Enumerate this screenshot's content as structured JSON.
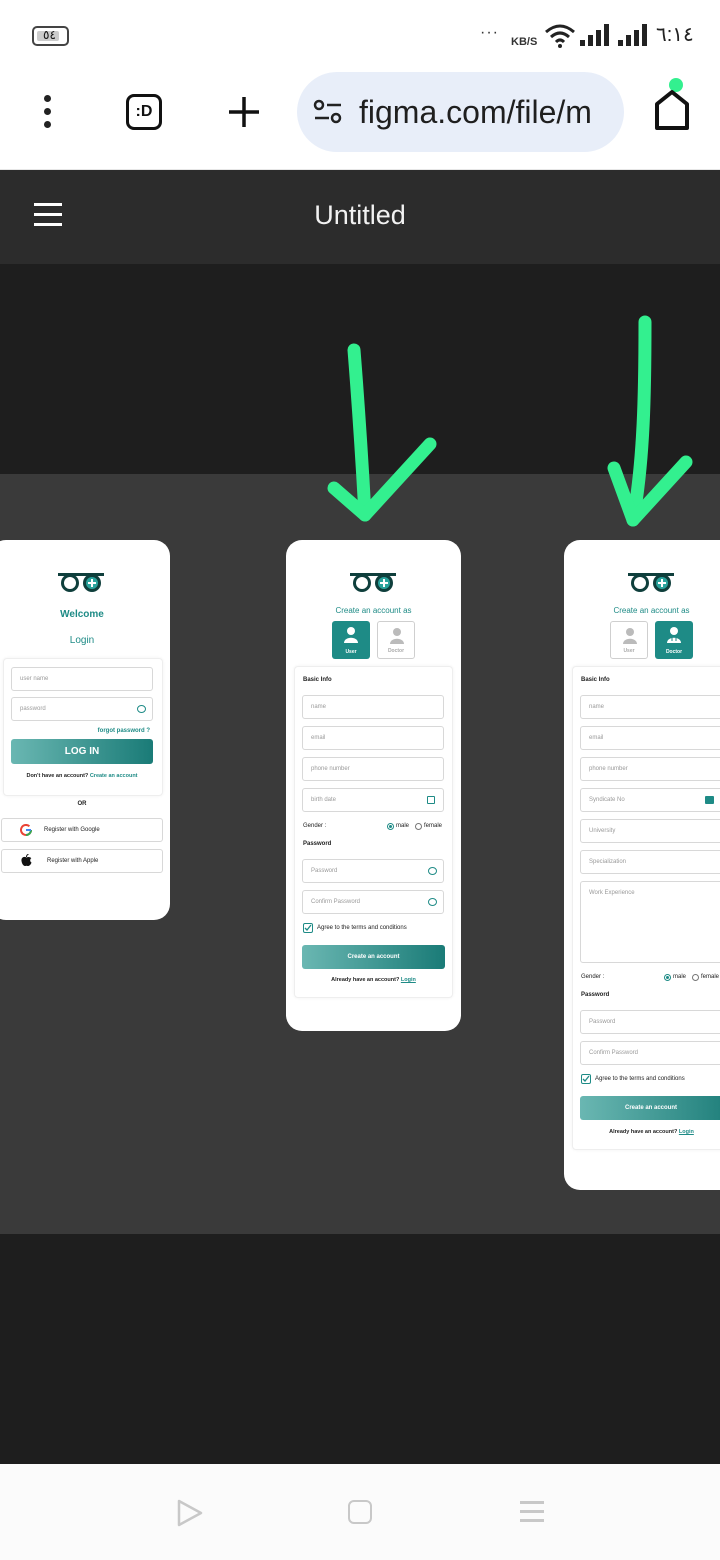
{
  "status_bar": {
    "battery": "٥٤",
    "dots": "···",
    "net_speed": "KB/S",
    "time": "٦:١٤"
  },
  "browser": {
    "url": "figma.com/file/m",
    "tabs_label": ":D"
  },
  "figma": {
    "file_title": "Untitled"
  },
  "login_frame": {
    "welcome": "Welcome",
    "login_title": "Login",
    "username_placeholder": "user name",
    "password_placeholder": "password",
    "forgot": "forgot password ?",
    "login_button": "LOG IN",
    "no_account": "Don't have an account?",
    "create_link": "Create an account",
    "or": "OR",
    "google": "Register with Google",
    "apple": "Register with Apple"
  },
  "user_frame": {
    "title": "Create an account as",
    "role_user": "User",
    "role_doctor": "Doctor",
    "basic_info": "Basic Info",
    "name": "name",
    "email": "email",
    "phone": "phone number",
    "birth": "birth date",
    "gender": "Gender :",
    "male": "male",
    "female": "female",
    "password_section": "Password",
    "password": "Password",
    "confirm": "Confirm Password",
    "agree": "Agree to the terms and conditions",
    "create_button": "Create an account",
    "already": "Already have an account?",
    "login_link": "Login"
  },
  "doctor_frame": {
    "title": "Create an account as",
    "role_user": "User",
    "role_doctor": "Doctor",
    "basic_info": "Basic Info",
    "name": "name",
    "email": "email",
    "phone": "phone number",
    "syndicate": "Syndicate No",
    "university": "University",
    "specialization": "Specialization",
    "experience": "Work Experience",
    "gender": "Gender :",
    "male": "male",
    "female": "female",
    "password_section": "Password",
    "password": "Password",
    "confirm": "Confirm Password",
    "agree": "Agree to the terms and conditions",
    "create_button": "Create an account",
    "already": "Already have an account?",
    "login_link": "Login"
  },
  "colors": {
    "teal": "#1e8b86",
    "arrow_green": "#33f08f",
    "figma_header": "#2c2c2c",
    "canvas": "#3a3a3a"
  },
  "icons": [
    "battery-icon",
    "wifi-icon",
    "signal-icon",
    "menu-dots-icon",
    "tabs-icon",
    "plus-icon",
    "site-settings-icon",
    "home-icon",
    "hamburger-icon",
    "eye-icon",
    "calendar-icon",
    "google-icon",
    "apple-icon",
    "person-icon",
    "doctor-icon",
    "arrow-down-icon",
    "play-icon",
    "square-icon",
    "lines-icon"
  ]
}
